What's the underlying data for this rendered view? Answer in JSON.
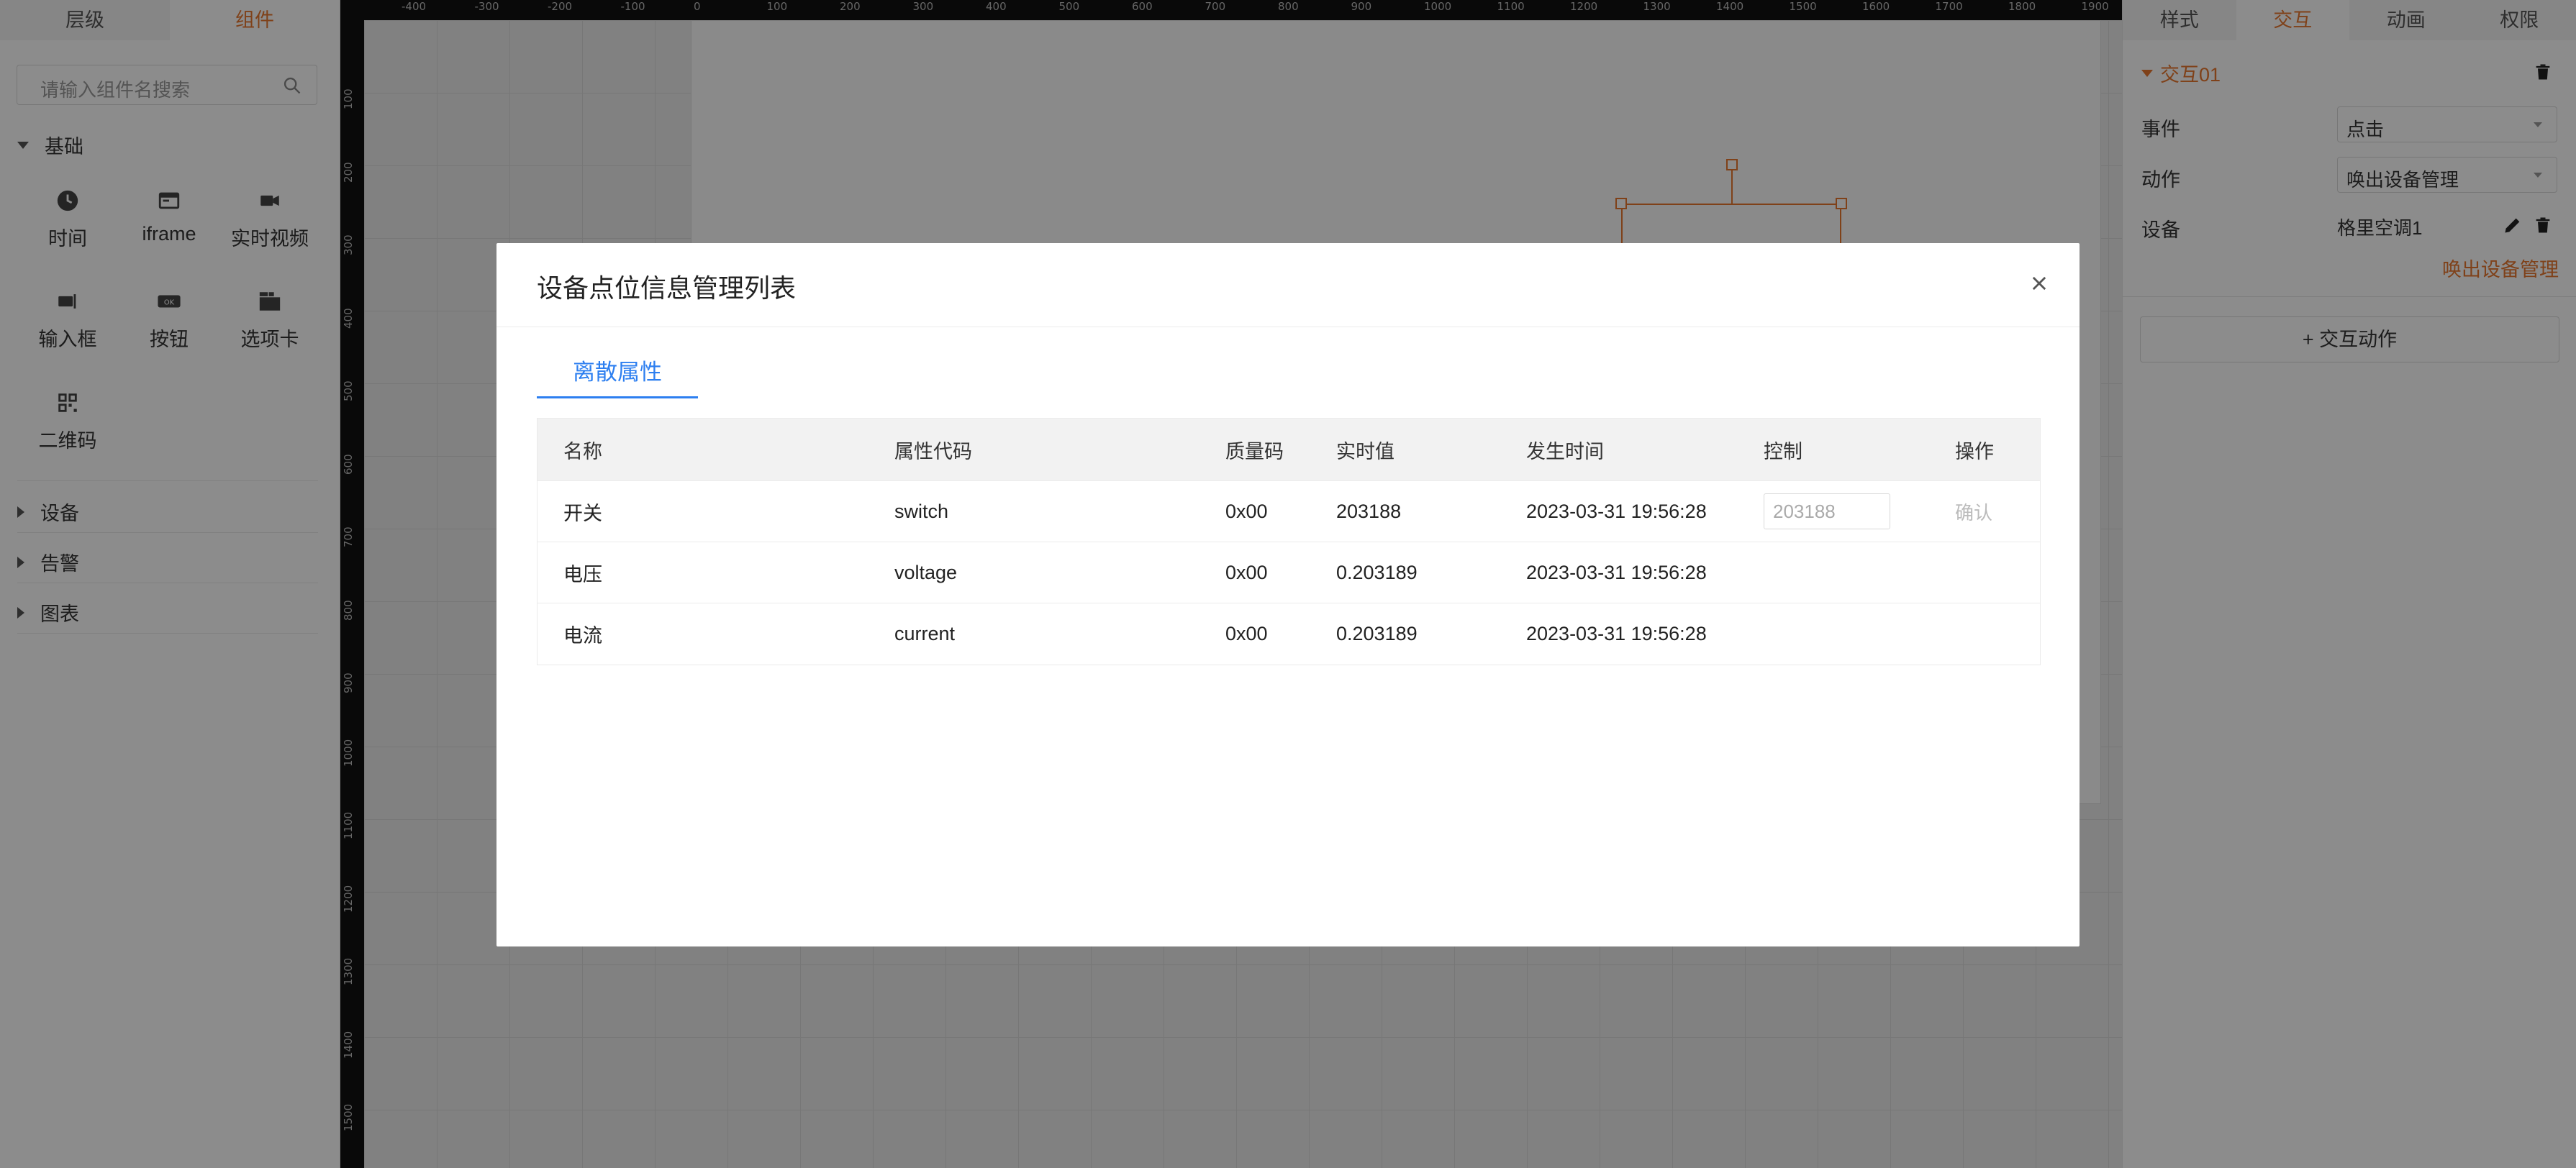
{
  "left_panel": {
    "tabs": [
      {
        "label": "层级"
      },
      {
        "label": "组件"
      }
    ],
    "search_placeholder": "请输入组件名搜索",
    "categories": {
      "basic": "基础",
      "device": "设备",
      "alarm": "告警",
      "chart": "图表"
    },
    "components": [
      {
        "label": "时间",
        "icon": "clock-icon"
      },
      {
        "label": "iframe",
        "icon": "iframe-icon"
      },
      {
        "label": "实时视频",
        "icon": "video-camera-icon"
      },
      {
        "label": "输入框",
        "icon": "input-box-icon"
      },
      {
        "label": "按钮",
        "icon": "ok-button-icon"
      },
      {
        "label": "选项卡",
        "icon": "tabs-icon"
      },
      {
        "label": "二维码",
        "icon": "qrcode-icon"
      }
    ]
  },
  "ruler": {
    "top_ticks": [
      "-400",
      "-300",
      "-200",
      "-100",
      "0",
      "100",
      "200",
      "300",
      "400",
      "500",
      "600",
      "700",
      "800",
      "900",
      "1000",
      "1100",
      "1200",
      "1300",
      "1400",
      "1500",
      "1600",
      "1700",
      "1800",
      "1900"
    ],
    "left_ticks": [
      "100",
      "200",
      "300",
      "400",
      "500",
      "600",
      "700",
      "800",
      "900",
      "1000",
      "1100",
      "1200",
      "1300",
      "1400",
      "1500"
    ]
  },
  "right_panel": {
    "tabs": [
      {
        "label": "样式"
      },
      {
        "label": "交互"
      },
      {
        "label": "动画"
      },
      {
        "label": "权限"
      }
    ],
    "interaction_title": "交互01",
    "event_label": "事件",
    "event_value": "点击",
    "action_label": "动作",
    "action_value": "唤出设备管理",
    "device_label": "设备",
    "device_value": "格里空调1",
    "action_link": "唤出设备管理",
    "add_action": "+ 交互动作"
  },
  "modal": {
    "title": "设备点位信息管理列表",
    "tab": "离散属性",
    "columns": [
      "名称",
      "属性代码",
      "质量码",
      "实时值",
      "发生时间",
      "控制",
      "操作"
    ],
    "rows": [
      {
        "name": "开关",
        "code": "switch",
        "quality": "0x00",
        "value": "203188",
        "time": "2023-03-31 19:56:28",
        "control_placeholder": "203188",
        "op": "确认"
      },
      {
        "name": "电压",
        "code": "voltage",
        "quality": "0x00",
        "value": "0.203189",
        "time": "2023-03-31 19:56:28"
      },
      {
        "name": "电流",
        "code": "current",
        "quality": "0x00",
        "value": "0.203189",
        "time": "2023-03-31 19:56:28"
      }
    ]
  },
  "colors": {
    "accent": "#e8772e",
    "link_blue": "#2d7ff0"
  }
}
